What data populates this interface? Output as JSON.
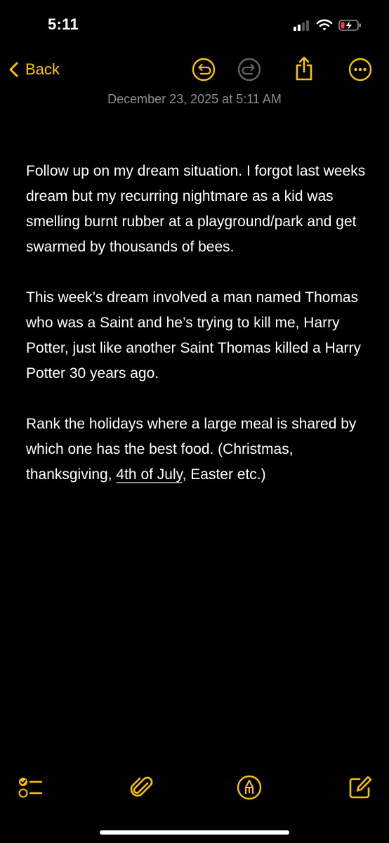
{
  "status_bar": {
    "time": "5:11",
    "icons": [
      "cellular-signal-icon",
      "wifi-icon",
      "battery-low-charging-icon"
    ]
  },
  "nav": {
    "back_label": "Back",
    "icons": [
      "undo-icon",
      "redo-icon",
      "share-icon",
      "more-icon"
    ]
  },
  "note": {
    "date": "December 23, 2025 at 5:11 AM",
    "paragraph_1": "Follow up on my dream situation. I forgot last weeks dream but my recurring nightmare as a kid was smelling burnt rubber at a playground/park and get swarmed by thousands of bees.",
    "paragraph_2": "This week’s dream involved a man named Thomas who was a Saint and he’s trying to kill me, Harry Potter, just like another Saint Thomas killed a Harry Potter 30 years ago.",
    "paragraph_3_before": "Rank the holidays where a large meal is shared by which one has the best food. (Christmas, thanksgiving, ",
    "paragraph_3_link": "4th of July",
    "paragraph_3_after": ", Easter etc.)"
  },
  "toolbar": {
    "icons": [
      "checklist-icon",
      "paperclip-icon",
      "markup-pen-icon",
      "compose-icon"
    ]
  },
  "colors": {
    "accent": "#f5c20e",
    "background": "#000000",
    "text": "#ffffff",
    "secondary_text": "#8e8e93",
    "battery_low": "#ff3b30"
  }
}
